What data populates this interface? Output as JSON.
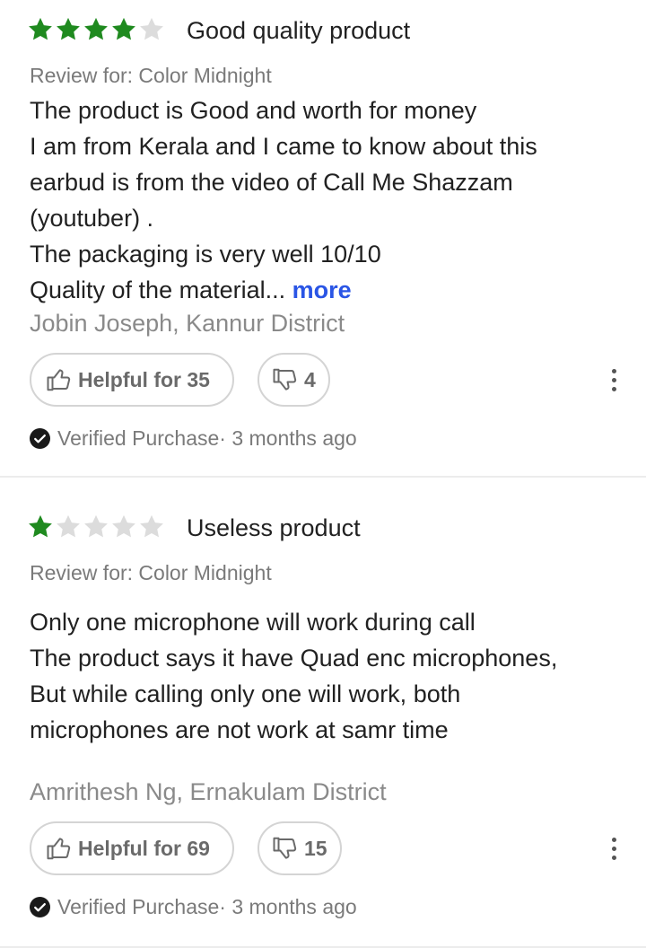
{
  "colors": {
    "star_filled": "#1f8a1f",
    "star_empty": "#dcdcdc",
    "more_link": "#2a55e5"
  },
  "reviews": [
    {
      "rating": 4,
      "title": "Good quality product",
      "review_for": "Review for: Color Midnight",
      "body_lines": [
        "The product is Good and worth for money",
        "I am from Kerala and I came to know about this",
        "earbud is from the video of Call Me Shazzam",
        "(youtuber) .",
        "The packaging is very well 10/10",
        "Quality of the material..."
      ],
      "more_label": "more",
      "author": "Jobin Joseph, Kannur District",
      "helpful_label": "Helpful for 35",
      "unhelpful_count": "4",
      "verified_label": "Verified Purchase",
      "time_ago": "· 3 months ago"
    },
    {
      "rating": 1,
      "title": "Useless product",
      "review_for": "Review for: Color Midnight",
      "body_lines": [
        "Only one microphone will work during call",
        "The product says it have Quad enc microphones,",
        "But while calling only one will work, both",
        "microphones are not work at samr time"
      ],
      "author": "Amrithesh Ng, Ernakulam District",
      "helpful_label": "Helpful for 69",
      "unhelpful_count": "15",
      "verified_label": "Verified Purchase",
      "time_ago": "· 3 months ago"
    }
  ]
}
